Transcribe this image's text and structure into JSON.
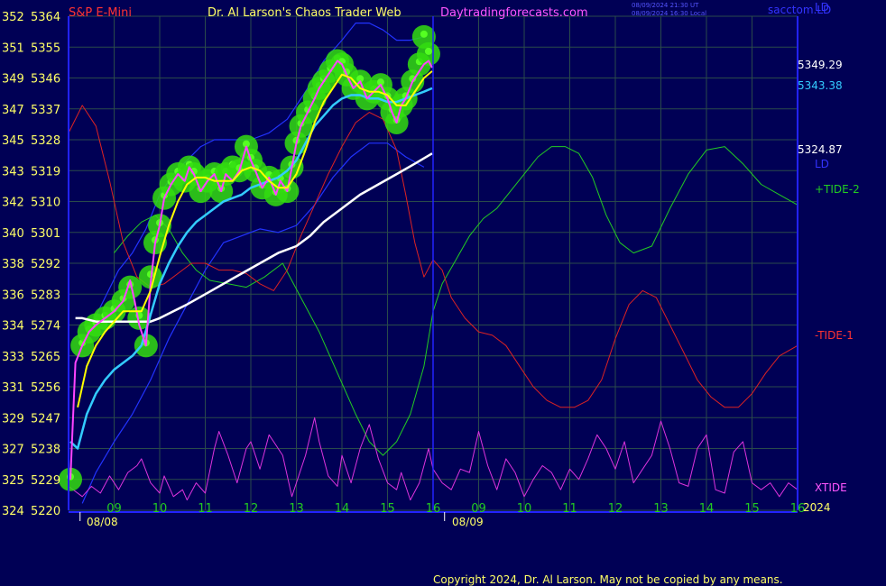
{
  "header": {
    "symbol": "S&P E-Mini",
    "author": "Dr. Al Larson's Chaos Trader Web",
    "site": "Daytradingforecasts.com",
    "timestamp_utc": "08/09/2024 21:30 UT",
    "timestamp_local": "08/09/2024 16:30 Local",
    "brand": "sacctom.LD"
  },
  "copyright": "Copyright 2024, Dr. Al Larson. May not be copied by any means.",
  "colors": {
    "background": "#000055",
    "grid": "#2a4a4a",
    "axis": "#2222ff",
    "price": "#ff44ff",
    "yellow_ma": "#ffff00",
    "cyan_ma": "#33ccff",
    "white_ma": "#ffffff",
    "tide2": "#22cc22",
    "tide1": "#dd2222",
    "xtide": "#dd33dd",
    "band": "#2233ff",
    "glow": "#33dd11",
    "label_red": "#ff3333",
    "label_yellow": "#ffff66",
    "label_magenta": "#ff55ff",
    "label_blue": "#4444ff"
  },
  "chart_data": {
    "type": "line",
    "y_axis_left": [
      {
        "level": "352",
        "price": 5364
      },
      {
        "level": "351",
        "price": 5355
      },
      {
        "level": "349",
        "price": 5346
      },
      {
        "level": "347",
        "price": 5337
      },
      {
        "level": "345",
        "price": 5328
      },
      {
        "level": "343",
        "price": 5319
      },
      {
        "level": "342",
        "price": 5310
      },
      {
        "level": "340",
        "price": 5301
      },
      {
        "level": "338",
        "price": 5292
      },
      {
        "level": "336",
        "price": 5283
      },
      {
        "level": "334",
        "price": 5274
      },
      {
        "level": "333",
        "price": 5265
      },
      {
        "level": "331",
        "price": 5256
      },
      {
        "level": "329",
        "price": 5247
      },
      {
        "level": "327",
        "price": 5238
      },
      {
        "level": "325",
        "price": 5229
      },
      {
        "level": "324",
        "price": 5220
      }
    ],
    "ylim": [
      5220,
      5364
    ],
    "x_ticks": [
      {
        "hour": 9,
        "label": "09"
      },
      {
        "hour": 10,
        "label": "10"
      },
      {
        "hour": 11,
        "label": "11"
      },
      {
        "hour": 12,
        "label": "12"
      },
      {
        "hour": 13,
        "label": "13"
      },
      {
        "hour": 14,
        "label": "14"
      },
      {
        "hour": 15,
        "label": "15"
      },
      {
        "hour": 16,
        "label": "16"
      },
      {
        "hour": 17,
        "label": "09"
      },
      {
        "hour": 18,
        "label": "10"
      },
      {
        "hour": 19,
        "label": "11"
      },
      {
        "hour": 20,
        "label": "12"
      },
      {
        "hour": 21,
        "label": "13"
      },
      {
        "hour": 22,
        "label": "14"
      },
      {
        "hour": 23,
        "label": "15"
      },
      {
        "hour": 24,
        "label": "16"
      }
    ],
    "date_labels": [
      {
        "hour": 8.45,
        "label": "08/08"
      },
      {
        "hour": 16.45,
        "label": "08/09"
      }
    ],
    "year_label": "2024",
    "divider_hour": 16.0,
    "right_labels": [
      {
        "name": "last-price",
        "text": "5349.29",
        "price": 5349.29
      },
      {
        "name": "cyan-ma-value",
        "text": "5343.38",
        "price": 5343.38
      },
      {
        "name": "white-ma-value",
        "text": "5324.87",
        "price": 5324.87
      }
    ],
    "series_labels": [
      {
        "name": "ld-top",
        "text": "LD"
      },
      {
        "name": "ld-mid",
        "text": "LD"
      },
      {
        "name": "tide2",
        "text": "+TIDE-2"
      },
      {
        "name": "tide1",
        "text": "-TIDE-1"
      },
      {
        "name": "xtide",
        "text": "XTIDE"
      }
    ],
    "price_series": {
      "x": [
        8.04,
        8.15,
        8.3,
        8.45,
        8.6,
        8.8,
        9.0,
        9.2,
        9.35,
        9.45,
        9.55,
        9.7,
        9.8,
        9.9,
        10.0,
        10.1,
        10.25,
        10.4,
        10.55,
        10.65,
        10.75,
        10.9,
        11.05,
        11.2,
        11.35,
        11.45,
        11.6,
        11.75,
        11.9,
        12.0,
        12.1,
        12.25,
        12.4,
        12.55,
        12.65,
        12.8,
        12.9,
        13.0,
        13.1,
        13.25,
        13.4,
        13.5,
        13.6,
        13.75,
        13.9,
        14.0,
        14.1,
        14.25,
        14.4,
        14.55,
        14.7,
        14.85,
        15.0,
        15.1,
        15.2,
        15.3,
        15.4,
        15.55,
        15.7,
        15.8,
        15.9,
        15.98
      ],
      "y": [
        5229,
        5263,
        5268,
        5272,
        5274,
        5276,
        5278,
        5281,
        5287,
        5281,
        5274,
        5268,
        5286,
        5298,
        5303,
        5311,
        5315,
        5318,
        5316,
        5320,
        5318,
        5313,
        5316,
        5318,
        5313,
        5318,
        5316,
        5319,
        5326,
        5322,
        5319,
        5314,
        5317,
        5312,
        5316,
        5313,
        5320,
        5327,
        5332,
        5336,
        5340,
        5343,
        5345,
        5348,
        5351,
        5350,
        5347,
        5343,
        5345,
        5340,
        5342,
        5344,
        5340,
        5336,
        5333,
        5338,
        5340,
        5345,
        5348,
        5350,
        5351,
        5349
      ]
    },
    "yellow_ma": {
      "x": [
        8.2,
        8.4,
        8.6,
        8.8,
        9.0,
        9.2,
        9.4,
        9.6,
        9.8,
        10.0,
        10.2,
        10.4,
        10.6,
        10.8,
        11.0,
        11.2,
        11.4,
        11.6,
        11.8,
        12.0,
        12.2,
        12.4,
        12.6,
        12.8,
        13.0,
        13.2,
        13.4,
        13.6,
        13.8,
        14.0,
        14.2,
        14.4,
        14.6,
        14.8,
        15.0,
        15.2,
        15.4,
        15.6,
        15.8,
        15.98
      ],
      "y": [
        5250,
        5262,
        5268,
        5272,
        5275,
        5278,
        5278,
        5278,
        5284,
        5294,
        5303,
        5310,
        5315,
        5317,
        5317,
        5316,
        5316,
        5316,
        5319,
        5320,
        5319,
        5316,
        5314,
        5314,
        5318,
        5325,
        5333,
        5339,
        5343,
        5347,
        5346,
        5343,
        5342,
        5342,
        5341,
        5338,
        5338,
        5342,
        5346,
        5348
      ]
    },
    "cyan_ma": {
      "x": [
        8.04,
        8.2,
        8.4,
        8.6,
        8.8,
        9.0,
        9.2,
        9.4,
        9.6,
        9.8,
        10.0,
        10.2,
        10.4,
        10.6,
        10.8,
        11.0,
        11.2,
        11.4,
        11.6,
        11.8,
        12.0,
        12.2,
        12.4,
        12.6,
        12.8,
        13.0,
        13.2,
        13.4,
        13.6,
        13.8,
        14.0,
        14.2,
        14.4,
        14.6,
        14.8,
        15.0,
        15.2,
        15.4,
        15.6,
        15.8,
        15.98
      ],
      "y": [
        5240,
        5238,
        5248,
        5254,
        5258,
        5261,
        5263,
        5265,
        5268,
        5277,
        5286,
        5292,
        5297,
        5301,
        5304,
        5306,
        5308,
        5310,
        5311,
        5312,
        5314,
        5315,
        5316,
        5317,
        5319,
        5322,
        5327,
        5332,
        5335,
        5338,
        5340,
        5341,
        5341,
        5340,
        5340,
        5339,
        5339,
        5340,
        5341,
        5342,
        5343
      ]
    },
    "white_ma": {
      "x": [
        8.15,
        8.3,
        8.6,
        9.0,
        9.4,
        9.6,
        9.8,
        10.0,
        10.3,
        10.6,
        11.0,
        11.4,
        11.8,
        12.2,
        12.6,
        13.0,
        13.3,
        13.6,
        14.0,
        14.4,
        14.8,
        15.2,
        15.6,
        15.98
      ],
      "y": [
        5276,
        5276,
        5275,
        5275,
        5275,
        5275,
        5275,
        5276,
        5278,
        5280,
        5283,
        5286,
        5289,
        5292,
        5295,
        5297,
        5300,
        5304,
        5308,
        5312,
        5315,
        5318,
        5321,
        5324
      ]
    },
    "upper_band": {
      "x": [
        8.5,
        8.8,
        9.1,
        9.4,
        9.7,
        10.0,
        10.3,
        10.6,
        10.9,
        11.2,
        11.6,
        12.0,
        12.4,
        12.8,
        13.2,
        13.6,
        14.0,
        14.3,
        14.6,
        14.9,
        15.2,
        15.5,
        15.8
      ],
      "y": [
        5274,
        5282,
        5290,
        5295,
        5302,
        5312,
        5318,
        5322,
        5326,
        5328,
        5328,
        5328,
        5330,
        5334,
        5342,
        5351,
        5357,
        5362,
        5362,
        5360,
        5357,
        5357,
        5358
      ]
    },
    "lower_band": {
      "x": [
        8.3,
        8.6,
        9.0,
        9.4,
        9.8,
        10.2,
        10.6,
        11.0,
        11.4,
        11.8,
        12.2,
        12.6,
        13.0,
        13.4,
        13.8,
        14.2,
        14.6,
        15.0,
        15.4,
        15.8
      ],
      "y": [
        5222,
        5231,
        5240,
        5248,
        5258,
        5270,
        5280,
        5290,
        5298,
        5300,
        5302,
        5301,
        5303,
        5309,
        5317,
        5323,
        5327,
        5327,
        5323,
        5320
      ]
    },
    "tide2_series": {
      "x": [
        9.0,
        9.3,
        9.6,
        9.9,
        10.2,
        10.5,
        10.8,
        11.1,
        11.5,
        11.9,
        12.3,
        12.7,
        13.1,
        13.5,
        13.9,
        14.3,
        14.6,
        14.9,
        15.2,
        15.5,
        15.8,
        16.0,
        16.2,
        16.5,
        16.8,
        17.1,
        17.4,
        17.7,
        18.0,
        18.3,
        18.6,
        18.9,
        19.2,
        19.5,
        19.8,
        20.1,
        20.4,
        20.8,
        21.2,
        21.6,
        22.0,
        22.4,
        22.8,
        23.2,
        23.6,
        24.0
      ],
      "y": [
        5295,
        5300,
        5304,
        5306,
        5302,
        5295,
        5290,
        5287,
        5286,
        5285,
        5288,
        5292,
        5282,
        5272,
        5260,
        5248,
        5240,
        5236,
        5240,
        5248,
        5262,
        5278,
        5286,
        5293,
        5300,
        5305,
        5308,
        5313,
        5318,
        5323,
        5326,
        5326,
        5324,
        5317,
        5306,
        5298,
        5295,
        5297,
        5308,
        5318,
        5325,
        5326,
        5321,
        5315,
        5312,
        5309
      ]
    },
    "tide1_series": {
      "x": [
        8.0,
        8.3,
        8.6,
        8.9,
        9.2,
        9.5,
        9.8,
        10.1,
        10.4,
        10.7,
        11.0,
        11.3,
        11.6,
        11.9,
        12.2,
        12.5,
        12.8,
        13.1,
        13.4,
        13.7,
        14.0,
        14.3,
        14.6,
        14.9,
        15.2,
        15.4,
        15.6,
        15.8,
        16.0,
        16.2,
        16.4,
        16.7,
        17.0,
        17.3,
        17.6,
        17.9,
        18.2,
        18.5,
        18.8,
        19.1,
        19.4,
        19.7,
        20.0,
        20.3,
        20.6,
        20.9,
        21.2,
        21.5,
        21.8,
        22.1,
        22.4,
        22.7,
        23.0,
        23.3,
        23.6,
        24.0
      ],
      "y": [
        5330,
        5338,
        5332,
        5316,
        5298,
        5288,
        5285,
        5286,
        5289,
        5292,
        5292,
        5290,
        5290,
        5289,
        5286,
        5284,
        5290,
        5300,
        5309,
        5318,
        5326,
        5333,
        5336,
        5334,
        5325,
        5312,
        5298,
        5288,
        5293,
        5290,
        5282,
        5276,
        5272,
        5271,
        5268,
        5262,
        5256,
        5252,
        5250,
        5250,
        5252,
        5258,
        5270,
        5280,
        5284,
        5282,
        5274,
        5266,
        5258,
        5253,
        5250,
        5250,
        5254,
        5260,
        5265,
        5268
      ]
    },
    "xtide_series": {
      "x": [
        8.0,
        8.3,
        8.5,
        8.7,
        8.9,
        9.1,
        9.3,
        9.5,
        9.6,
        9.8,
        10.0,
        10.1,
        10.3,
        10.5,
        10.6,
        10.8,
        11.0,
        11.2,
        11.3,
        11.5,
        11.7,
        11.9,
        12.0,
        12.2,
        12.4,
        12.5,
        12.7,
        12.9,
        13.0,
        13.2,
        13.4,
        13.5,
        13.7,
        13.9,
        14.0,
        14.2,
        14.4,
        14.6,
        14.8,
        15.0,
        15.2,
        15.3,
        15.5,
        15.7,
        15.9,
        16.0,
        16.2,
        16.4,
        16.6,
        16.8,
        17.0,
        17.2,
        17.4,
        17.6,
        17.8,
        18.0,
        18.2,
        18.4,
        18.6,
        18.8,
        19.0,
        19.2,
        19.4,
        19.6,
        19.8,
        20.0,
        20.2,
        20.4,
        20.6,
        20.8,
        21.0,
        21.2,
        21.4,
        21.6,
        21.8,
        22.0,
        22.2,
        22.4,
        22.6,
        22.8,
        23.0,
        23.2,
        23.4,
        23.6,
        23.8,
        24.0
      ],
      "y": [
        5227,
        5224,
        5227,
        5225,
        5230,
        5226,
        5231,
        5233,
        5235,
        5228,
        5225,
        5230,
        5224,
        5226,
        5223,
        5228,
        5225,
        5238,
        5243,
        5236,
        5228,
        5238,
        5240,
        5232,
        5242,
        5240,
        5236,
        5224,
        5228,
        5236,
        5247,
        5240,
        5230,
        5227,
        5236,
        5228,
        5238,
        5245,
        5235,
        5228,
        5226,
        5231,
        5223,
        5228,
        5238,
        5232,
        5228,
        5226,
        5232,
        5231,
        5243,
        5233,
        5226,
        5235,
        5231,
        5224,
        5229,
        5233,
        5231,
        5226,
        5232,
        5229,
        5235,
        5242,
        5238,
        5232,
        5240,
        5228,
        5232,
        5236,
        5246,
        5238,
        5228,
        5227,
        5238,
        5242,
        5226,
        5225,
        5237,
        5240,
        5228,
        5226,
        5228,
        5224,
        5228,
        5226
      ]
    },
    "glow_points": {
      "x": [
        8.04,
        8.3,
        8.45,
        8.6,
        8.8,
        9.0,
        9.2,
        9.35,
        9.55,
        9.7,
        9.8,
        9.9,
        10.0,
        10.1,
        10.25,
        10.4,
        10.55,
        10.65,
        10.75,
        10.9,
        11.05,
        11.2,
        11.35,
        11.45,
        11.6,
        11.75,
        11.9,
        12.0,
        12.1,
        12.25,
        12.4,
        12.55,
        12.65,
        12.8,
        12.9,
        13.0,
        13.1,
        13.25,
        13.4,
        13.5,
        13.6,
        13.75,
        13.9,
        14.0,
        14.1,
        14.25,
        14.4,
        14.55,
        14.7,
        14.85,
        15.0,
        15.1,
        15.2,
        15.3,
        15.4,
        15.55,
        15.7,
        15.8,
        15.9
      ],
      "y": [
        5229,
        5268,
        5272,
        5274,
        5276,
        5278,
        5281,
        5285,
        5276,
        5268,
        5288,
        5298,
        5303,
        5311,
        5315,
        5318,
        5316,
        5320,
        5318,
        5313,
        5316,
        5318,
        5313,
        5318,
        5320,
        5319,
        5326,
        5322,
        5319,
        5314,
        5317,
        5312,
        5316,
        5313,
        5320,
        5327,
        5332,
        5336,
        5340,
        5343,
        5345,
        5348,
        5351,
        5350,
        5347,
        5343,
        5345,
        5340,
        5342,
        5344,
        5340,
        5336,
        5333,
        5338,
        5340,
        5345,
        5350,
        5358,
        5353
      ]
    }
  }
}
